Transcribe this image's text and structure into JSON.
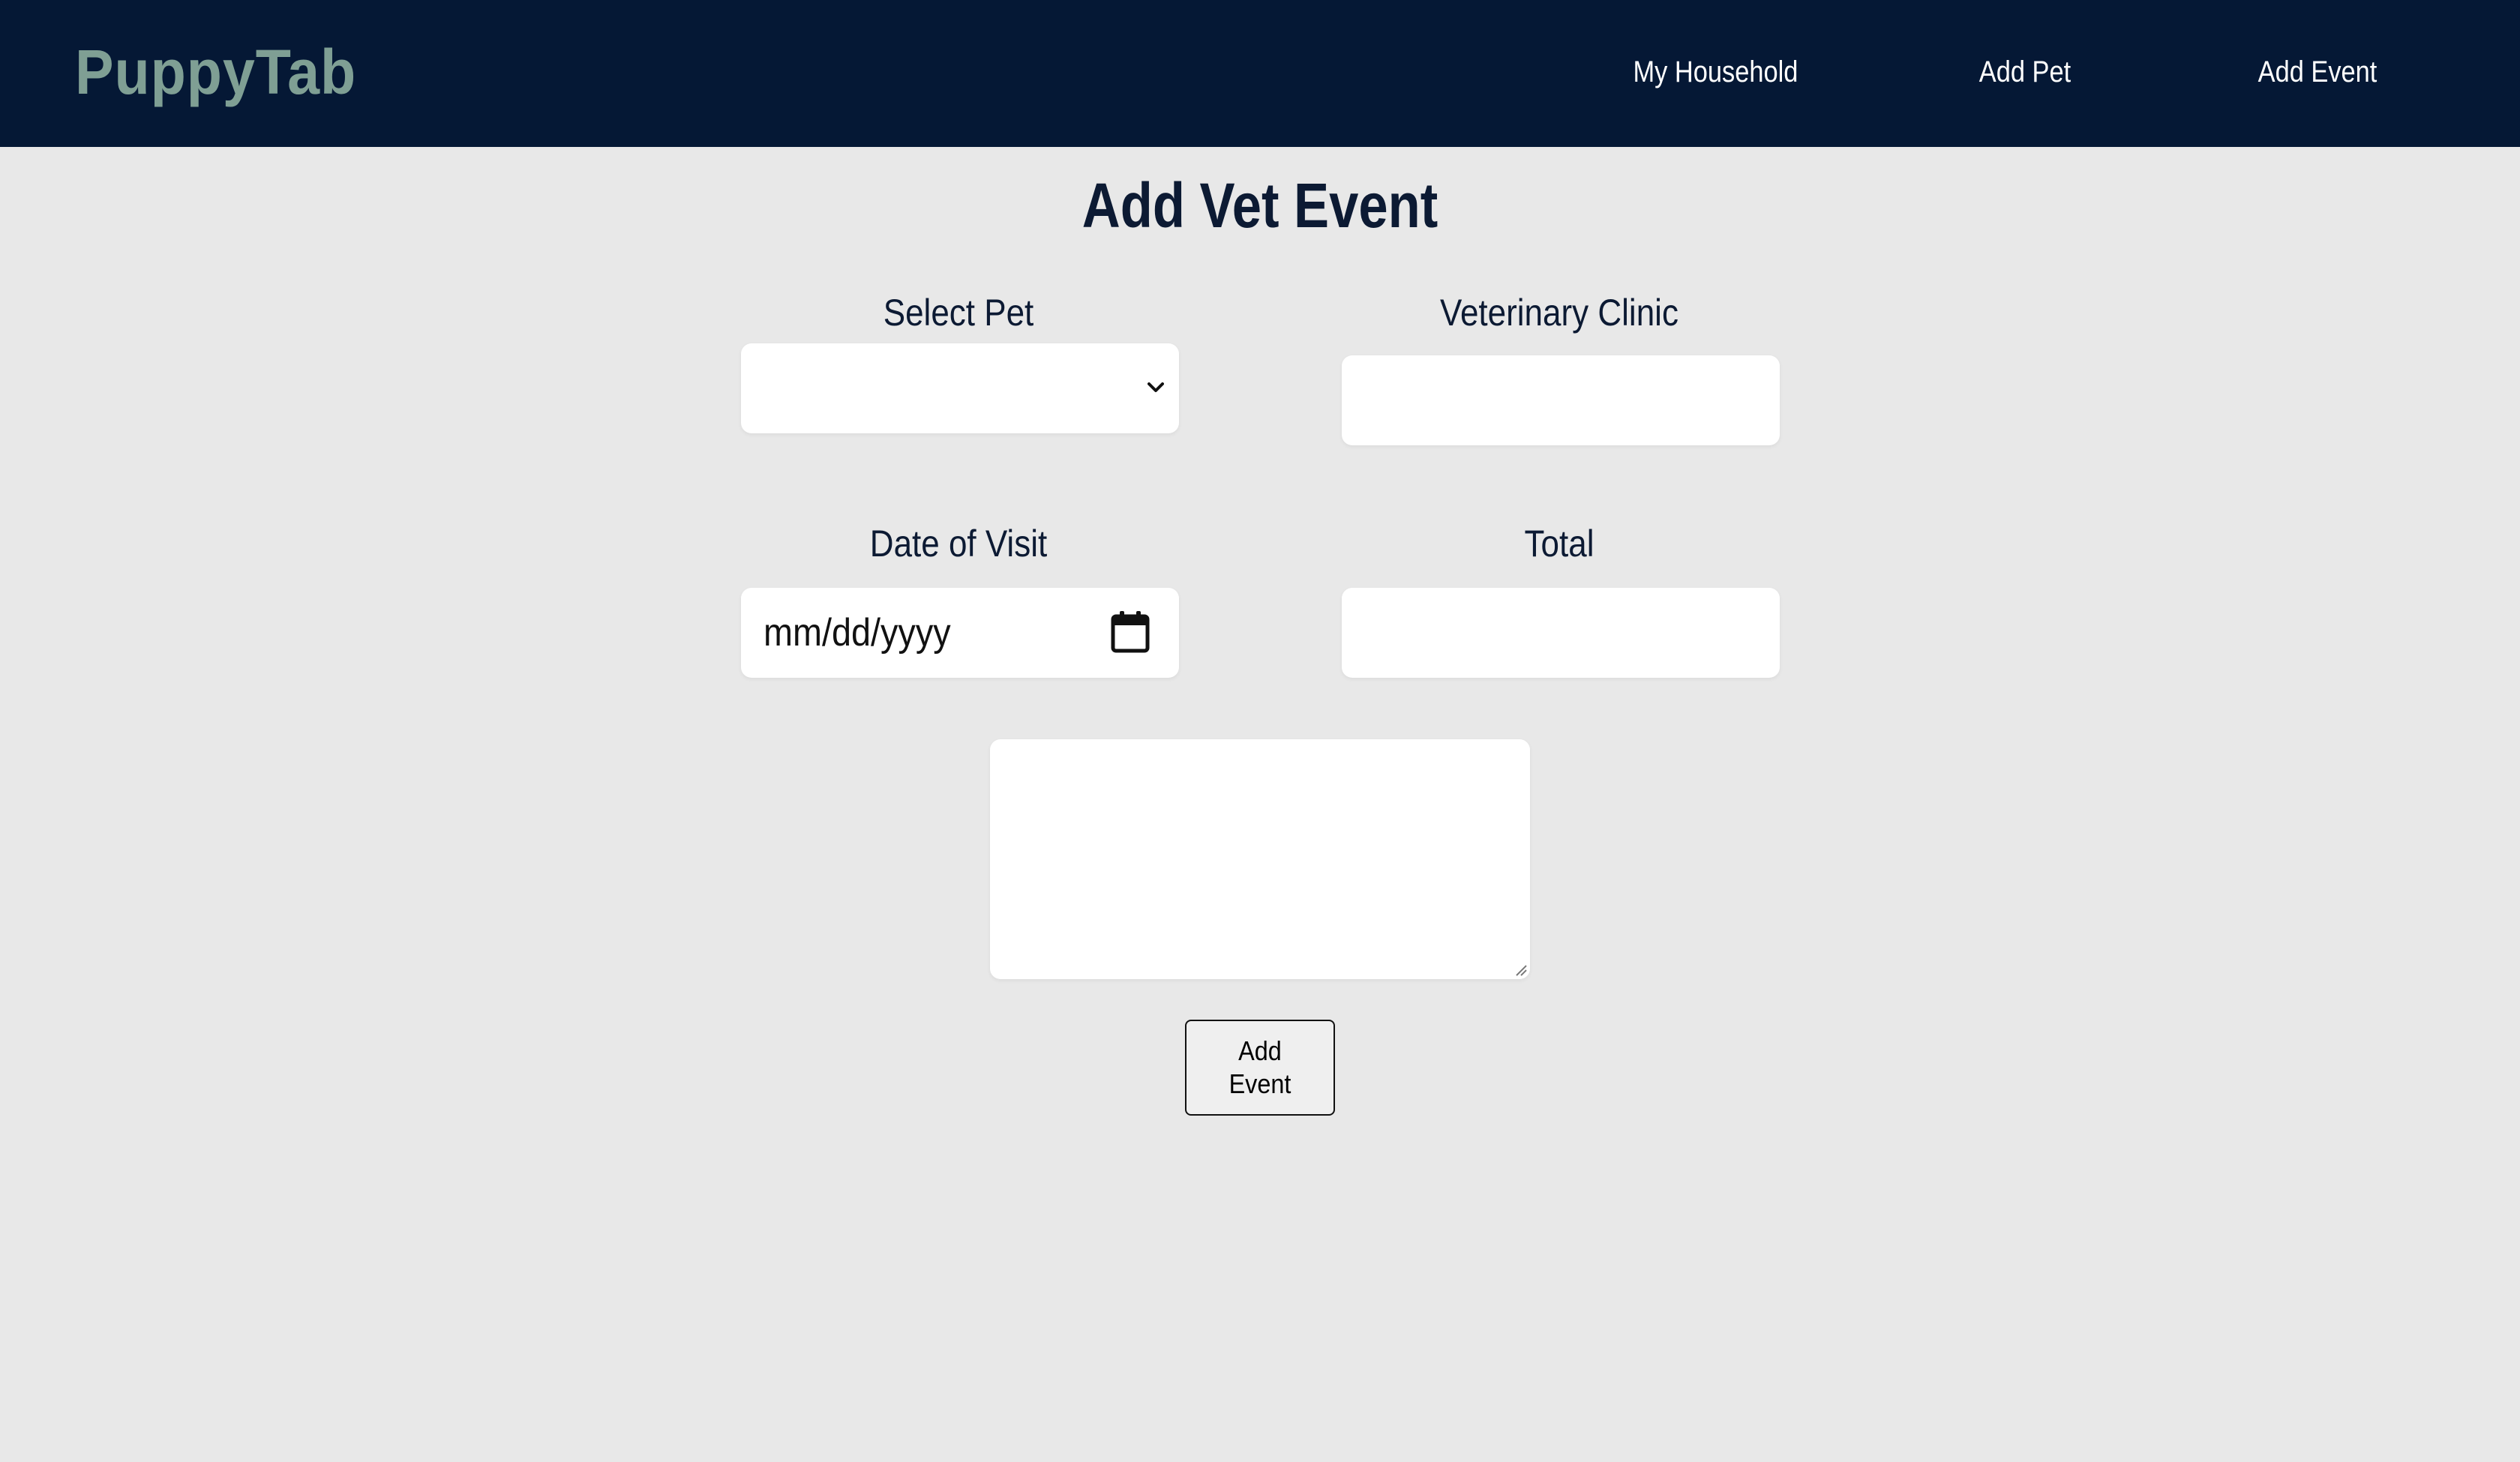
{
  "header": {
    "brand": "PuppyTab",
    "nav": [
      {
        "label": "My Household"
      },
      {
        "label": "Add Pet"
      },
      {
        "label": "Add Event"
      }
    ]
  },
  "main": {
    "title": "Add Vet Event",
    "fields": {
      "pet": {
        "label": "Select Pet",
        "value": ""
      },
      "clinic": {
        "label": "Veterinary Clinic",
        "value": ""
      },
      "date": {
        "label": "Date of Visit",
        "placeholder": "mm/dd/yyyy"
      },
      "total": {
        "label": "Total",
        "value": ""
      },
      "notes": {
        "value": ""
      }
    },
    "submit_label": "Add Event"
  },
  "colors": {
    "header_bg": "#051835",
    "brand": "#7f9f94",
    "page_bg": "#e8e8e8",
    "text_dark": "#0c1a33"
  },
  "icons": {
    "select_chevron": "chevron-down-icon",
    "date_picker": "calendar-icon",
    "textarea_resize": "resize-grip-icon"
  }
}
